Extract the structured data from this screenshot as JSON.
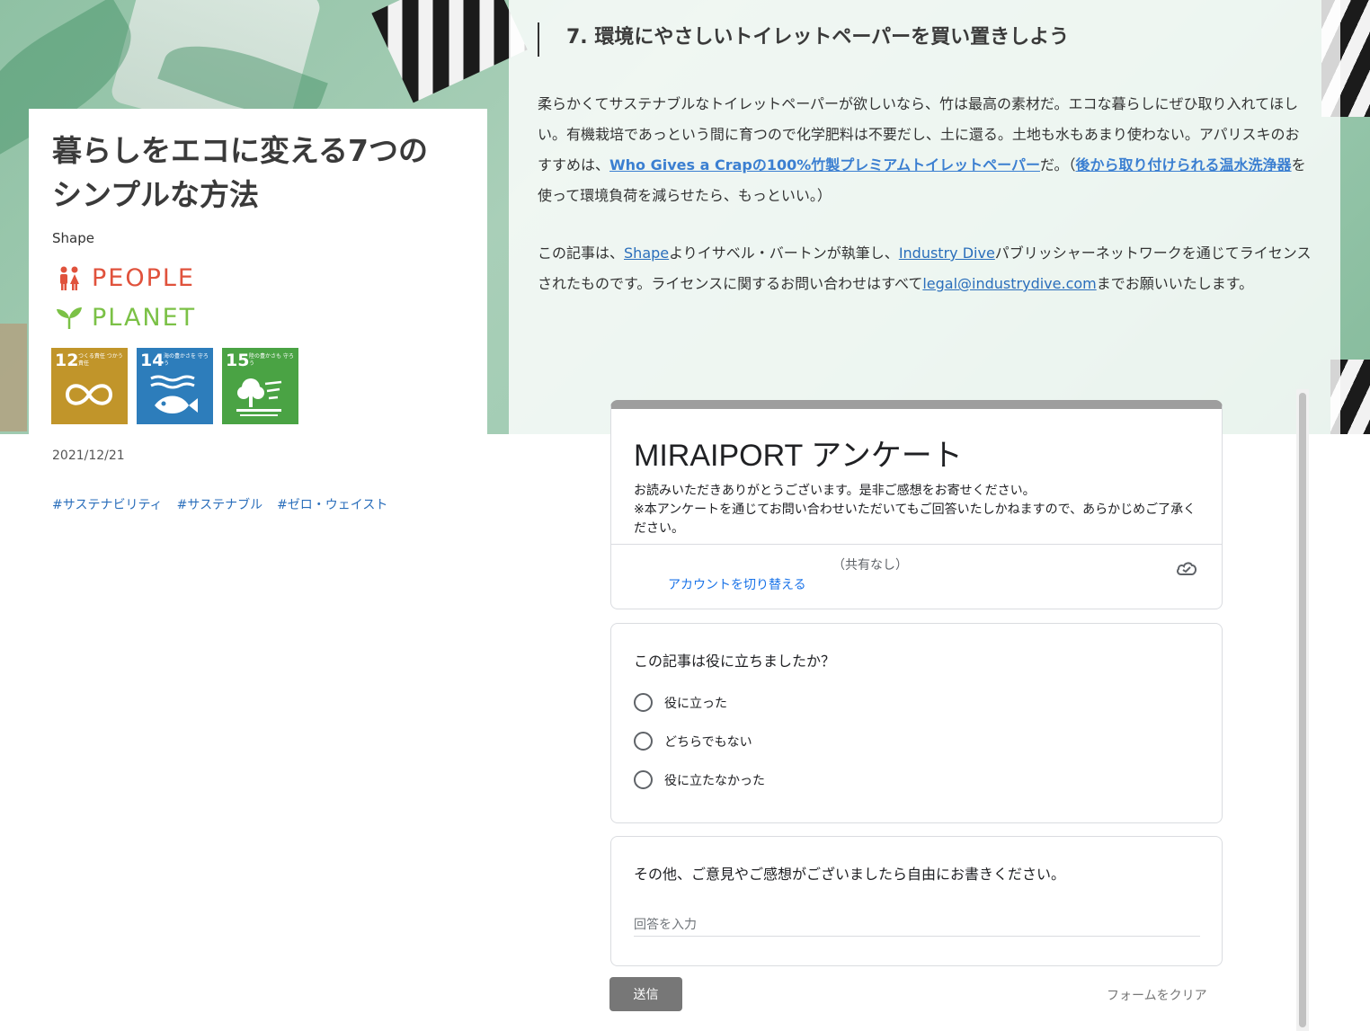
{
  "article": {
    "title_line1": "暮らしをエコに変える7つの",
    "title_line2": "シンプルな方法",
    "source": "Shape",
    "categories": {
      "people": "PEOPLE",
      "planet": "PLANET"
    },
    "sdgs": [
      {
        "num": "12",
        "label": "つくる責任 つかう責任",
        "color": "#c1952a",
        "icon": "infinity-icon"
      },
      {
        "num": "14",
        "label": "海の豊かさを 守ろう",
        "color": "#2d7dbb",
        "icon": "fish-icon"
      },
      {
        "num": "15",
        "label": "陸の豊かさも 守ろう",
        "color": "#4aa344",
        "icon": "tree-icon"
      }
    ],
    "date": "2021/12/21",
    "tags": [
      "#サステナビリティ",
      "#サステナブル",
      "#ゼロ・ウェイスト"
    ],
    "section_heading": "7. 環境にやさしいトイレットペーパーを買い置きしよう",
    "p1": {
      "text_a": "柔らかくてサステナブルなトイレットペーパーが欲しいなら、竹は最高の素材だ。エコな暮らしにぜひ取り入れてほしい。有機栽培であっという間に育つので化学肥料は不要だし、土に還る。土地も水もあまり使わない。アパリスキのおすすめは、",
      "link1": "Who Gives a Crapの100%竹製プレミアムトイレットペーパー",
      "text_b": "だ。（",
      "link2": "後から取り付けられる温水洗浄器",
      "text_c": "を使って環境負荷を減らせたら、もっといい。）"
    },
    "p2": {
      "text_a": "この記事は、",
      "link1": "Shape",
      "text_b": "よりイサベル・バートンが執筆し、",
      "link2": "Industry Dive",
      "text_c": "パブリッシャーネットワークを通じてライセンスされたものです。ライセンスに関するお問い合わせはすべて",
      "link3": "legal@industrydive.com",
      "text_d": "までお願いいたします。"
    }
  },
  "form": {
    "title": "MIRAIPORT アンケート",
    "desc_line1": "お読みいただきありがとうございます。是非ご感想をお寄せください。",
    "desc_line2": "※本アンケートを通じてお問い合わせいただいてもご回答いたしかねますので、あらかじめご了承ください。",
    "no_share": "（共有なし）",
    "switch_account": "アカウントを切り替える",
    "q1": {
      "label": "この記事は役に立ちましたか？",
      "options": [
        "役に立った",
        "どちらでもない",
        "役に立たなかった"
      ]
    },
    "q2": {
      "label": "その他、ご意見やご感想がございましたら自由にお書きください。",
      "placeholder": "回答を入力"
    },
    "submit": "送信",
    "clear": "フォームをクリア"
  },
  "colors": {
    "people": "#e0523c",
    "planet": "#7bc146",
    "link": "#2a6ebb",
    "form_accent": "#9e9e9e"
  }
}
